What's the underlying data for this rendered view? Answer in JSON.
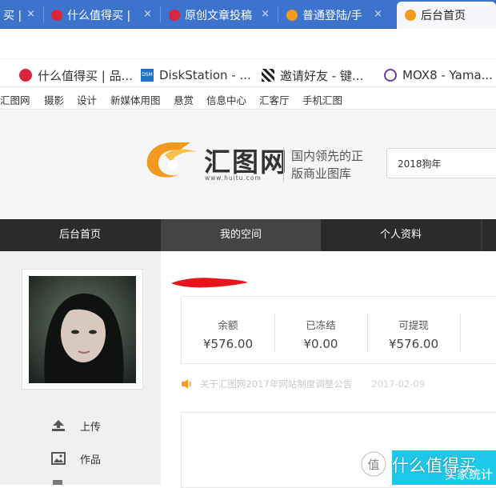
{
  "browser": {
    "tabs": [
      {
        "label": "买 |",
        "icon": "zhihu-icon",
        "active": false
      },
      {
        "label": "什么值得买 |",
        "icon": "smzdm-icon",
        "active": false
      },
      {
        "label": "原创文章投稿",
        "icon": "smzdm-icon",
        "active": false
      },
      {
        "label": "普通登陆/手",
        "icon": "huitu-icon",
        "active": false
      },
      {
        "label": "后台首页",
        "icon": "huitu-icon",
        "active": true
      }
    ],
    "tab_close_glyph": "×",
    "bookmarks": [
      {
        "label": "什么值得买 | 品...",
        "icon": "smzdm-icon"
      },
      {
        "label": "DiskStation - ...",
        "icon": "dsm-icon",
        "icon_text": "DSM"
      },
      {
        "label": "邀请好友 - 键...",
        "icon": "tool-icon"
      },
      {
        "label": "MOX8 - Yama...",
        "icon": "mox-icon"
      }
    ]
  },
  "site_nav": {
    "items": [
      "汇图网",
      "摄影",
      "设计",
      "新媒体用图",
      "悬赏",
      "信息中心",
      "汇客厅",
      "手机汇图"
    ]
  },
  "header": {
    "logo_text": "汇图网",
    "logo_url": "www.huitu.com",
    "slogan_line1": "国内领先的正",
    "slogan_line2": "版商业图库",
    "search_value": "2018狗年"
  },
  "main_nav": {
    "items": [
      "后台首页",
      "我的空间",
      "个人资料"
    ],
    "active_index": 1
  },
  "sidebar": {
    "items": [
      {
        "label": "上传",
        "icon": "upload-icon"
      },
      {
        "label": "作品",
        "icon": "image-icon"
      }
    ]
  },
  "account": {
    "stats": [
      {
        "label": "余额",
        "value": "¥576.00"
      },
      {
        "label": "已冻结",
        "value": "¥0.00"
      },
      {
        "label": "可提现",
        "value": "¥576.00"
      }
    ],
    "notice": {
      "text": "关于汇图网2017年网站制度调整公告",
      "date": "2017-02-09"
    }
  },
  "overlay": {
    "watermark": "什么值得买",
    "button_partial_label": "买家统计"
  },
  "colors": {
    "tabstrip": "#3d73cc",
    "nav_bg": "#2b2b2b",
    "nav_active": "#444444",
    "accent_orange": "#f39a1e",
    "cyan": "#1ec8e8",
    "redaction": "#e8141b"
  }
}
